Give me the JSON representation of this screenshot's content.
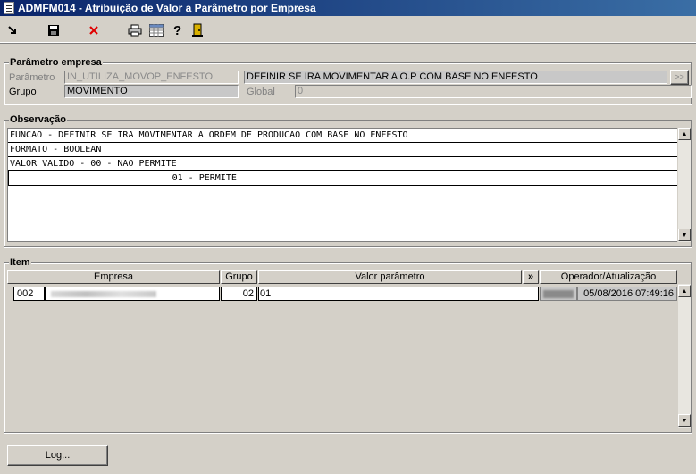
{
  "window": {
    "title": "ADMFM014 - Atribuição de Valor a Parâmetro por Empresa"
  },
  "toolbar": {
    "icons": [
      "exit-icon",
      "save-icon",
      "delete-icon",
      "print-icon",
      "grid-icon",
      "help-icon",
      "door-icon"
    ],
    "colors": {
      "delete": "#e00000",
      "door": "#d8b000"
    }
  },
  "param_group": {
    "title": "Parâmetro empresa",
    "parametro_label": "Parâmetro",
    "parametro_value": "IN_UTILIZA_MOVOP_ENFESTO",
    "descricao_value": "DEFINIR SE IRA MOVIMENTAR A O.P COM BASE NO ENFESTO",
    "grupo_label": "Grupo",
    "grupo_value": "MOVIMENTO",
    "global_label": "Global",
    "global_value": "0",
    "expand_label": ">>"
  },
  "obs_group": {
    "title": "Observação",
    "lines": [
      "FUNCAO - DEFINIR SE IRA MOVIMENTAR A ORDEM DE PRODUCAO COM BASE NO ENFESTO",
      "FORMATO - BOOLEAN",
      "VALOR VALIDO - 00 - NAO PERMITE",
      "                              01 - PERMITE"
    ]
  },
  "item_group": {
    "title": "Item",
    "columns": {
      "empresa": "Empresa",
      "grupo": "Grupo",
      "valor": "Valor parâmetro",
      "expand": "»",
      "operador": "Operador/Atualização"
    },
    "rows": [
      {
        "empresa_code": "002",
        "grupo": "02",
        "valor": "01",
        "data": "05/08/2016 07:49:16"
      }
    ]
  },
  "footer": {
    "log_button": "Log..."
  }
}
